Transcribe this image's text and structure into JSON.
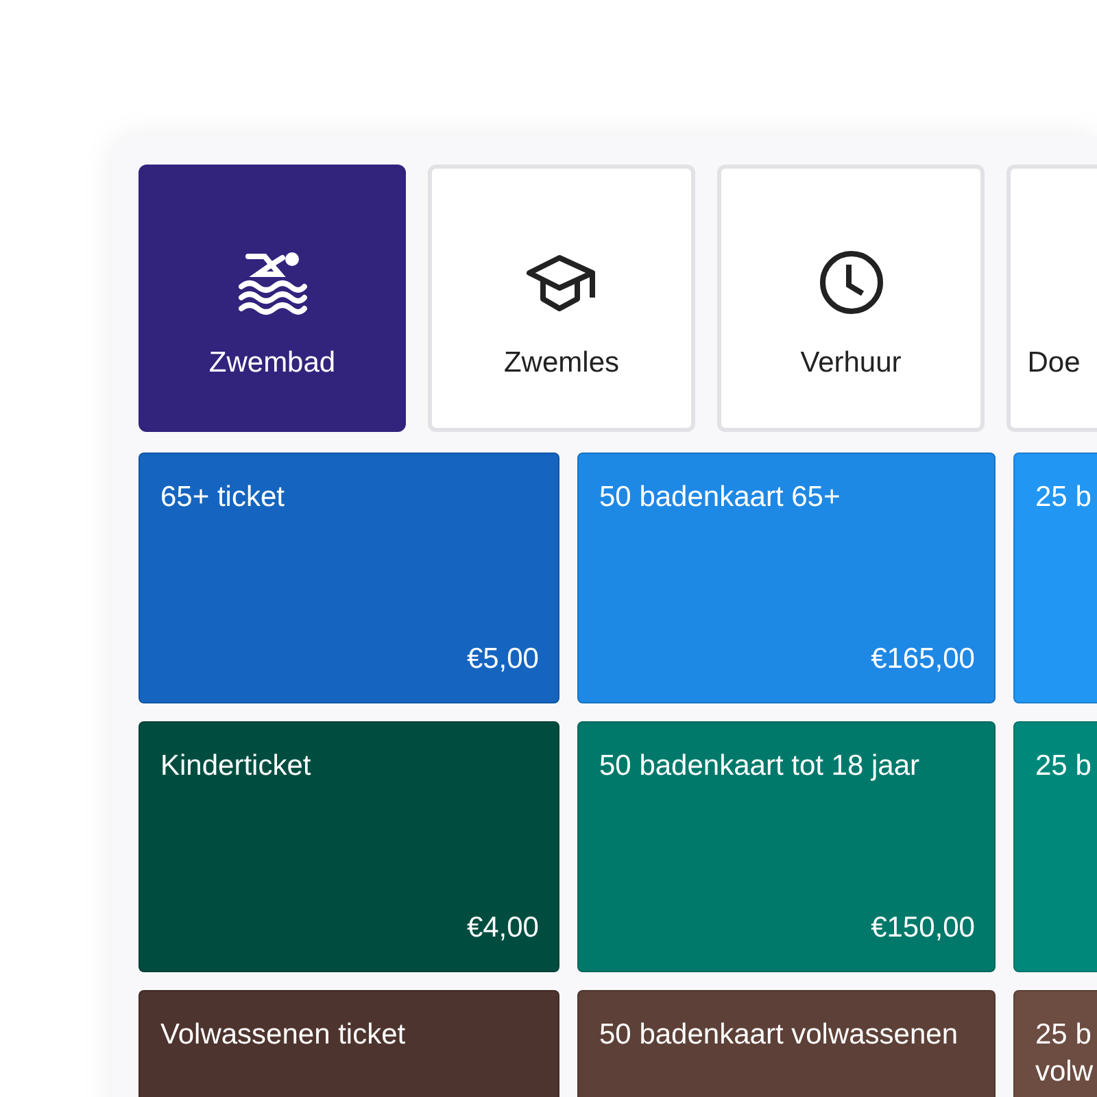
{
  "categories": [
    {
      "label": "Zwembad",
      "selected": true
    },
    {
      "label": "Zwemles",
      "selected": false
    },
    {
      "label": "Verhuur",
      "selected": false
    },
    {
      "label": "Doe",
      "selected": false
    }
  ],
  "products": [
    {
      "name": "65+ ticket",
      "price": "€5,00",
      "color": "#1565c0"
    },
    {
      "name": "50 badenkaart 65+",
      "price": "€165,00",
      "color": "#1e88e5"
    },
    {
      "name": "25 b",
      "color": "#2196f3"
    },
    {
      "name": "Kinderticket",
      "price": "€4,00",
      "color": "#004d40"
    },
    {
      "name": "50 badenkaart tot 18 jaar",
      "price": "€150,00",
      "color": "#00796b"
    },
    {
      "name": "25 b",
      "color": "#00897b"
    },
    {
      "name": "Volwassenen ticket",
      "color": "#4e342e"
    },
    {
      "name": "50 badenkaart volwassenen",
      "color": "#5d4037"
    },
    {
      "name": "25 b volw",
      "color": "#6d4c41"
    }
  ]
}
